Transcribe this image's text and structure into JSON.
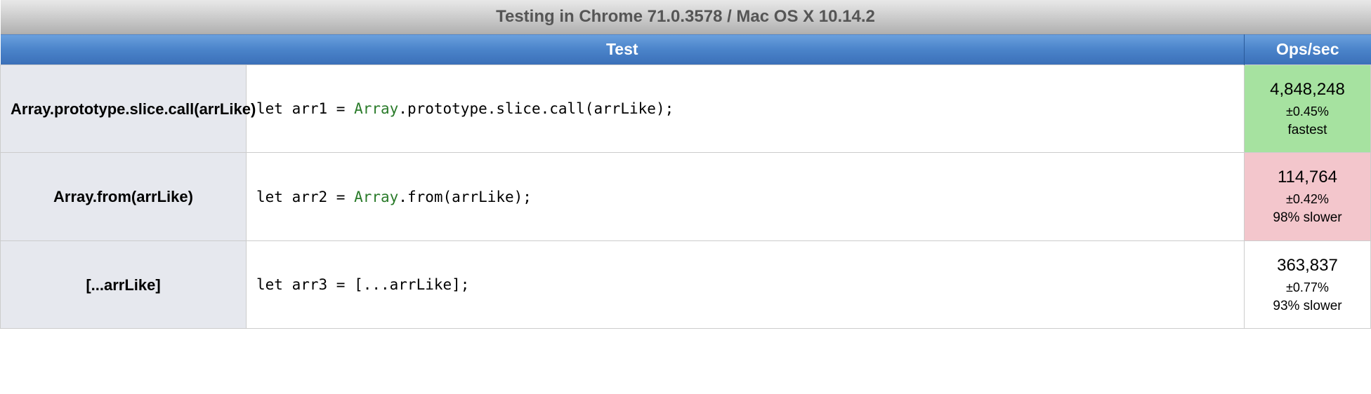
{
  "title": "Testing in Chrome 71.0.3578 / Mac OS X 10.14.2",
  "headers": {
    "test": "Test",
    "ops": "Ops/sec"
  },
  "rows": [
    {
      "name": "Array.prototype.slice.call(arrLike)",
      "code_prefix": "let arr1 = ",
      "code_ident": "Array",
      "code_suffix": ".prototype.slice.call(arrLike);",
      "ops": "4,848,248",
      "margin": "±0.45%",
      "note": "fastest",
      "status": "fastest"
    },
    {
      "name": "Array.from(arrLike)",
      "code_prefix": "let arr2 = ",
      "code_ident": "Array",
      "code_suffix": ".from(arrLike);",
      "ops": "114,764",
      "margin": "±0.42%",
      "note": "98% slower",
      "status": "slow"
    },
    {
      "name": "[...arrLike]",
      "code_prefix": "let arr3 = [...arrLike];",
      "code_ident": "",
      "code_suffix": "",
      "ops": "363,837",
      "margin": "±0.77%",
      "note": "93% slower",
      "status": "none"
    }
  ]
}
